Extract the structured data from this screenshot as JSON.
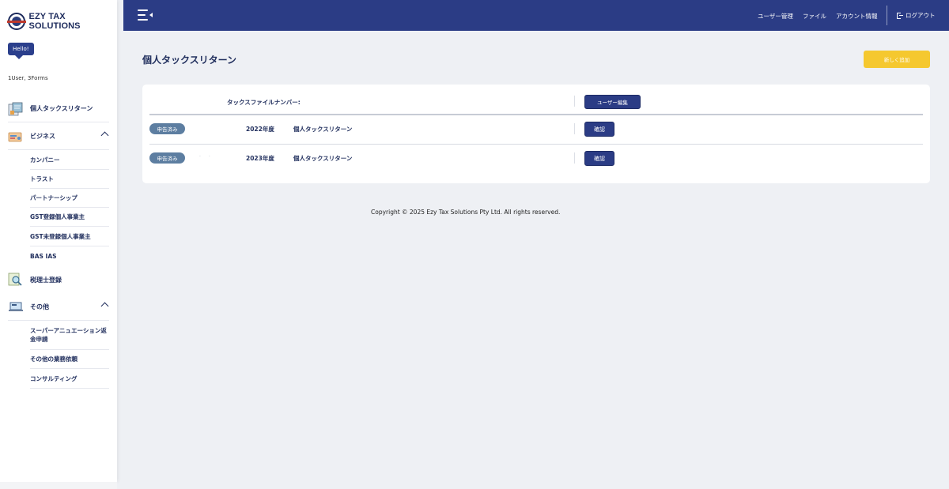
{
  "app": {
    "name": "EZY TAX SOLUTIONS"
  },
  "sidebar": {
    "greeting": "Hello!",
    "account_summary": "1User, 3Forms",
    "items": [
      {
        "label": "個人タックスリターン",
        "icon": "tax-return-icon"
      },
      {
        "label": "ビジネス",
        "icon": "business-card-icon",
        "expanded": true,
        "children": [
          "カンパニー",
          "トラスト",
          "パートナーシップ",
          "GST登録個人事業主",
          "GST未登録個人事業主",
          "BAS IAS"
        ]
      },
      {
        "label": "税理士登録",
        "icon": "tax-agent-search-icon"
      },
      {
        "label": "その他",
        "icon": "laptop-icon",
        "expanded": true,
        "children": [
          "スーパーアニュエーション返金申請",
          "その他の業務依頼",
          "コンサルティング"
        ]
      }
    ]
  },
  "header": {
    "nav": [
      "ユーザー管理",
      "ファイル",
      "アカウント情報"
    ],
    "logout_label": "ログアウト"
  },
  "main": {
    "title": "個人タックスリターン",
    "add_button_label": "新しく追加",
    "table": {
      "tfn_label": "タックスファイルナンバー:",
      "edit_user_label": "ユーザー編集",
      "rows": [
        {
          "status": "申告済み",
          "year": "2022年度",
          "form": "個人タックスリターン",
          "action": "確認"
        },
        {
          "status": "申告済み",
          "year": "2023年度",
          "form": "個人タックスリターン",
          "action": "確認"
        }
      ]
    }
  },
  "footer": {
    "copyright": "Copyright © 2025 Ezy Tax Solutions Pty Ltd. All rights reserved."
  },
  "colors": {
    "primary": "#2b3c85",
    "accent": "#f5c82f",
    "status": "#5d7ea1",
    "background": "#eef0f4"
  }
}
